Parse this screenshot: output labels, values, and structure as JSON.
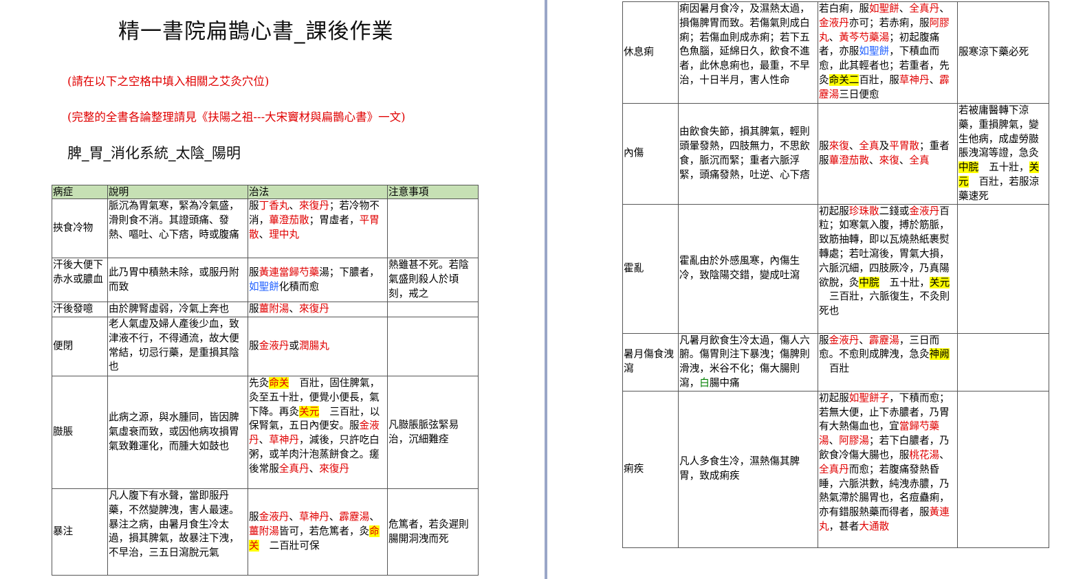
{
  "page1": {
    "title": "精一書院扁鵲心書_課後作業",
    "note1": "(請在以下之空格中填入相關之艾灸穴位)",
    "note2": "(完整的全書各論整理請見《扶陽之祖---大宋竇材與扁鵲心書》一文)",
    "heading": "脾_胃_消化系統_太陰_陽明",
    "headers": [
      "病症",
      "說明",
      "治法",
      "注意事項"
    ]
  },
  "rows": {
    "r1": {
      "disease": "挾食冷物",
      "explain": "脈沉為胃氣寒，緊為冷氣盛，滑則食不消。其證頭痛、發熱、嘔吐、心下痞，時或腹痛",
      "t": [
        "服",
        "丁香丸",
        "、",
        "來復丹",
        "；若冷物不消，",
        "蓽澄茄散",
        "；胃虛者，",
        "平胃散",
        "、",
        "理中丸"
      ],
      "caution": ""
    },
    "r2": {
      "disease": "汗後大便下赤水或膿血",
      "explain": "此乃胃中積熱未除，或服丹附而致",
      "t": [
        "服",
        "黃連當歸芍藥",
        "湯；下膿者，",
        "如聖餅",
        "化積而愈"
      ],
      "caution": "熱雖甚不死。若陰氣盛則殺人於頃刻，戒之"
    },
    "r3": {
      "disease": "汗後發噫",
      "explain": "由於脾腎虛弱，冷氣上奔也",
      "t": [
        "服",
        "薑附湯",
        "、",
        "來復丹"
      ],
      "caution": ""
    },
    "r4": {
      "disease": "便閉",
      "explain": "老人氣虛及婦人產後少血，致津液不行，不得通流，故大便常結，切忌行藥，是重損其陰也",
      "t": [
        "服",
        "金液丹",
        "或",
        "潤腸丸"
      ],
      "caution": ""
    },
    "r5": {
      "disease": "臌脹",
      "explain": "此病之源，與水腫同，皆因脾氣虛衰而致，或因他病攻損胃氣致難運化，而腫大如鼓也",
      "t": [
        "先灸",
        "命关",
        "百壯，固住脾氣，灸至五十壯，便覺小便長，氣下降。再灸",
        "关元",
        "三百壯，以保腎氣，五日內便安。服",
        "金液丹",
        "、",
        "草神丹",
        "，減後，只許吃白粥，或羊肉汁泡蒸餅食之。瘥後常服",
        "全真丹",
        "、",
        "來復丹"
      ],
      "caution": "凡臌脹脈弦緊易治，沉細難痊"
    },
    "r6": {
      "disease": "暴注",
      "explain": "凡人腹下有水聲，當即服丹藥，不然變脾洩，害人最速。暴注之病，由暑月食生冷太過，損其脾氣，故暴注下洩，不早治，三五日瀉脫元氣",
      "t": [
        "服",
        "金液丹",
        "、",
        "草神丹",
        "、",
        "霹靂湯",
        "、",
        "薑附湯",
        "皆可，若危篤者，灸",
        "命关",
        "二百壯可保"
      ],
      "caution": "危篤者，若灸遲則腸開洞洩而死"
    },
    "r7": {
      "disease": "休息痢",
      "explain": "痢因暑月食冷，及濕熱太過，損傷脾胃而致。若傷氣則成白痢；若傷血則成赤痢；若下五色魚腦，延綿日久，飲食不進者，此休息痢也，最重，不早治，十日半月，害人性命",
      "t": [
        "若白痢，服",
        "如聖餅",
        "、",
        "全真丹",
        "、",
        "金液丹",
        "亦可；若赤痢，服",
        "阿膠丸",
        "、",
        "黃芩芍藥湯",
        "；初起腹痛者，亦服",
        "如聖餅",
        "，下積血而愈，此其輕者也；若重者，先灸",
        "命关二",
        "百壯，服",
        "草神丹",
        "、",
        "霹靂湯",
        "三日便愈"
      ],
      "caution": "服寒涼下藥必死"
    },
    "r8": {
      "disease": "內傷",
      "explain": "由飲食失節，損其脾氣，輕則頭暈發熱，四肢無力，不思飲食，脈沉而緊；重者六脈浮緊，頭痛發熱，吐逆、心下痞",
      "t": [
        "服",
        "來復",
        "、",
        "全真",
        "及",
        "平胃散",
        "；重者服",
        "蓽澄茄散",
        "、",
        "來復",
        "、",
        "全真"
      ],
      "c": [
        "若被庸醫轉下涼藥，重損脾氣，變生他病，成虛勞臌脹洩瀉等證，急灸",
        "中脘",
        "五十壯，",
        "关元",
        "百壯，若服涼藥速死"
      ]
    },
    "r9": {
      "disease": "霍亂",
      "explain": "霍亂由於外感風寒，內傷生冷，致陰陽交錯，變成吐瀉",
      "t": [
        "初起服",
        "珍珠散",
        "二錢或",
        "金液丹",
        "百粒；如寒氣入腹，搏於筋脈，致筋抽轉，即以瓦燒熱紙裹熨轉處；若吐瀉後，胃氣大損，六脈沉細，四肢厥冷，乃真陽欲脫，灸",
        "中脘",
        "五十壯，",
        "关元",
        "三百壯，六脈復生，不灸則死也"
      ],
      "caution": ""
    },
    "r10": {
      "disease": "暑月傷食洩瀉",
      "e": [
        "凡暑月飲食生冷太過，傷人六腑。傷胃則注下暴洩；傷脾則滑洩，米谷不化；傷大腸則瀉，",
        "白",
        "腸中痛"
      ],
      "t": [
        "服",
        "金液丹",
        "、",
        "霹靂湯",
        "，三日而愈。不愈則成脾洩，急灸",
        "神阙",
        "百壯"
      ],
      "caution": ""
    },
    "r11": {
      "disease": "痢疾",
      "explain": "凡人多食生冷，濕熱傷其脾胃，致成痢疾",
      "t": [
        "初起服",
        "如聖餅子",
        "，下積而愈；若無大便，止下赤膿者，乃胃有大熱傷血也，宜",
        "當歸芍藥湯",
        "、",
        "阿膠湯",
        "；若下白膿者，乃飲食冷傷大腸也，服",
        "桃花湯",
        "、",
        "全真丹",
        "而愈；若腹痛發熱昏睡，六脈洪數，純洩赤膿，乃熱氣滯於腸胃也，名痘蠱痢，亦有錯服熱藥而得者，服",
        "黃連丸",
        "，甚者",
        "大通散"
      ],
      "caution": ""
    }
  },
  "colors": {
    "header_bg": "#c6e0b4",
    "remedy_red": "#e00000",
    "highlight_yellow": "#ffff00",
    "link_blue": "#1f5fff",
    "green": "#008000"
  }
}
